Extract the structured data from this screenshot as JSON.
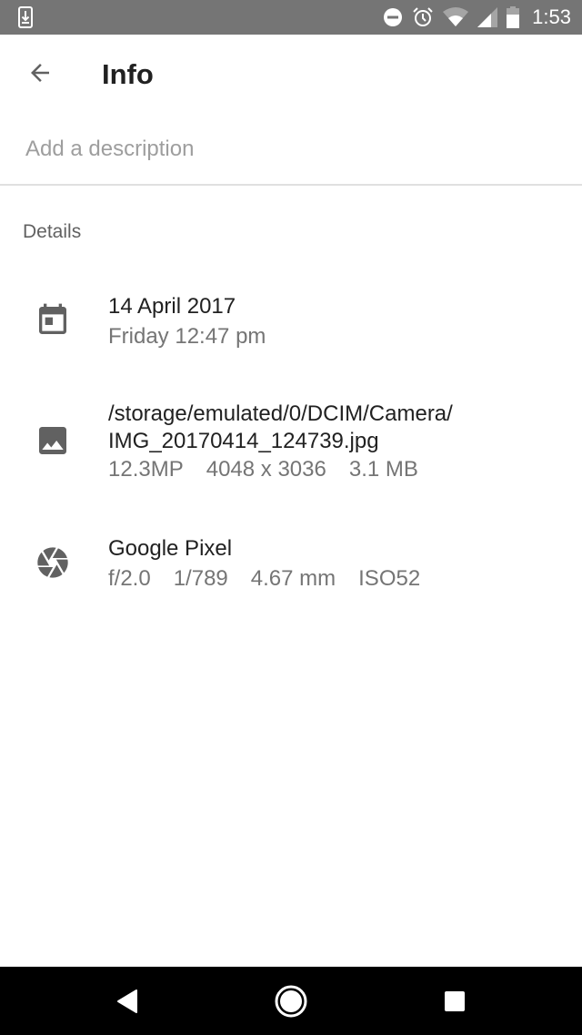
{
  "status_bar": {
    "left_icons": [
      "download-notification-icon"
    ],
    "right_icons": [
      "do-not-disturb-icon",
      "alarm-icon",
      "wifi-icon",
      "cell-signal-icon",
      "battery-icon"
    ],
    "time": "1:53"
  },
  "app_bar": {
    "back_icon": "arrow-back-icon",
    "title": "Info"
  },
  "description": {
    "value": "",
    "placeholder": "Add a description"
  },
  "details": {
    "header": "Details",
    "items": [
      {
        "icon": "calendar-icon",
        "primary": [
          "14 April 2017"
        ],
        "secondary": [
          "Friday 12:47 pm"
        ]
      },
      {
        "icon": "image-icon",
        "primary": [
          "/storage/emulated/0/DCIM/Camera/",
          "IMG_20170414_124739.jpg"
        ],
        "secondary": [
          "12.3MP",
          "4048 x 3036",
          "3.1 MB"
        ]
      },
      {
        "icon": "camera-aperture-icon",
        "primary": [
          "Google Pixel"
        ],
        "secondary": [
          "f/2.0",
          "1/789",
          "4.67 mm",
          "ISO52"
        ]
      }
    ]
  },
  "nav_bar": {
    "buttons": [
      "back-nav-icon",
      "home-nav-icon",
      "recents-nav-icon"
    ]
  },
  "colors": {
    "status_bar": "#757575",
    "primary_text": "#212121",
    "secondary_text": "#757575",
    "icon": "#616161",
    "divider": "#e0e0e0",
    "nav_bar": "#000000"
  }
}
